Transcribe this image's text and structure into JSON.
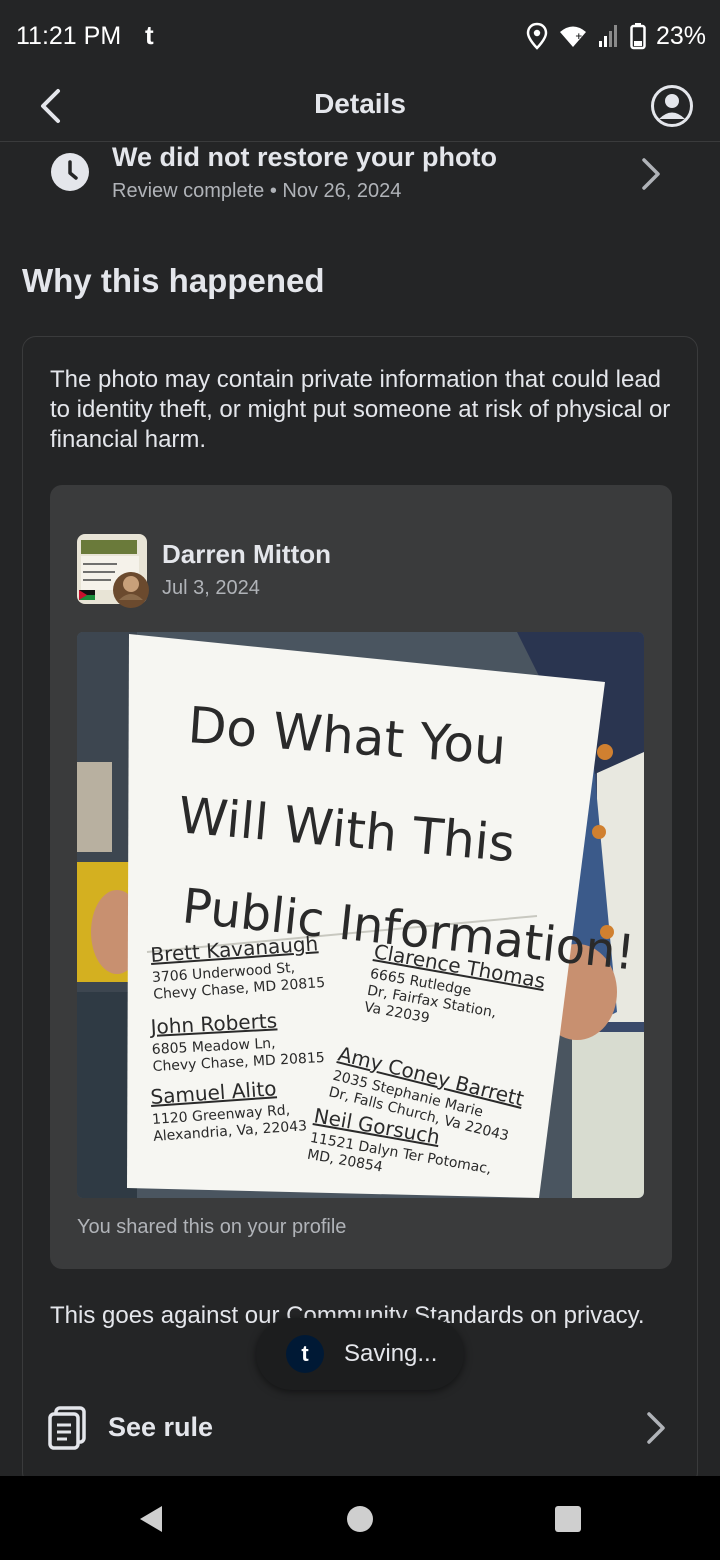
{
  "status_bar": {
    "time": "11:21 PM",
    "app_glyph": "t",
    "battery": "23%",
    "icons": [
      "location-icon",
      "wifi-icon",
      "signal-icon",
      "battery-icon"
    ]
  },
  "header": {
    "title": "Details"
  },
  "status": {
    "headline": "We did not restore your photo",
    "subline": "Review complete • Nov 26, 2024"
  },
  "section": {
    "title": "Why this happened"
  },
  "card": {
    "explanation": "The photo may contain private information that could lead to identity theft, or might put someone at risk of physical or financial harm.",
    "post": {
      "author": "Darren Mitton",
      "date": "Jul 3, 2024",
      "shared_note": "You shared this on your profile",
      "sign_heading": [
        "Do What You",
        "Will With This",
        "Public Information!"
      ],
      "sign_entries": [
        {
          "name": "Brett Kavanaugh",
          "addr1": "3706 Underwood St,",
          "addr2": "Chevy Chase, MD 20815"
        },
        {
          "name": "Clarence Thomas",
          "addr1": "6665 Rutledge",
          "addr2": "Dr, Fairfax Station,",
          "addr3": "Va 22039"
        },
        {
          "name": "John Roberts",
          "addr1": "6805 Meadow Ln,",
          "addr2": "Chevy Chase, MD 20815"
        },
        {
          "name": "Amy Coney Barrett",
          "addr1": "2035 Stephanie Marie",
          "addr2": "Dr, Falls Church, Va 22043"
        },
        {
          "name": "Samuel Alito",
          "addr1": "1120 Greenway Rd,",
          "addr2": "Alexandria, Va, 22043"
        },
        {
          "name": "Neil Gorsuch",
          "addr1": "11521 Dalyn Ter Potomac,",
          "addr2": "MD, 20854"
        }
      ]
    },
    "policy_text": "This goes against our Community Standards on privacy.",
    "see_rule": "See rule"
  },
  "toast": {
    "icon_letter": "t",
    "message": "Saving..."
  },
  "colors": {
    "background": "#242526",
    "post_bg": "#3a3b3c",
    "text_primary": "#e4e6eb",
    "text_secondary": "#b0b3b8"
  }
}
